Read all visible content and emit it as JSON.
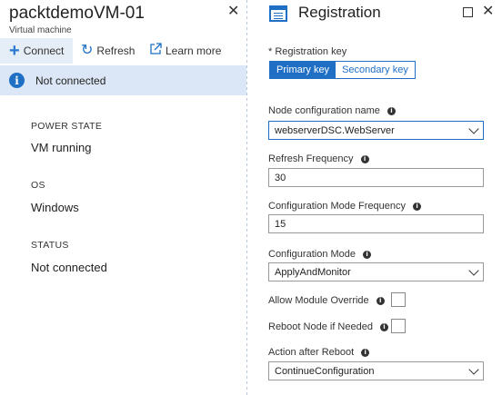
{
  "left_blade": {
    "title": "packtdemoVM-01",
    "subtitle": "Virtual machine",
    "toolbar": {
      "connect_label": "Connect",
      "refresh_label": "Refresh",
      "learn_more_label": "Learn more"
    },
    "banner": {
      "text": "Not connected"
    },
    "properties": [
      {
        "label": "POWER STATE",
        "value": "VM running"
      },
      {
        "label": "OS",
        "value": "Windows"
      },
      {
        "label": "STATUS",
        "value": "Not connected"
      }
    ]
  },
  "right_blade": {
    "title": "Registration",
    "registration_key": {
      "label": "* Registration key",
      "tabs": [
        "Primary key",
        "Secondary key"
      ],
      "selected": "Primary key"
    },
    "fields": {
      "node_configuration_name": {
        "label": "Node configuration name",
        "value": "webserverDSC.WebServer"
      },
      "refresh_frequency": {
        "label": "Refresh Frequency",
        "value": "30"
      },
      "configuration_mode_frequency": {
        "label": "Configuration Mode Frequency",
        "value": "15"
      },
      "configuration_mode": {
        "label": "Configuration Mode",
        "value": "ApplyAndMonitor"
      },
      "allow_module_override": {
        "label": "Allow Module Override",
        "checked": false
      },
      "reboot_node_if_needed": {
        "label": "Reboot Node if Needed",
        "checked": false
      },
      "action_after_reboot": {
        "label": "Action after Reboot",
        "value": "ContinueConfiguration"
      }
    }
  },
  "colors": {
    "accent": "#1f6fc5",
    "banner_bg": "#dbe7f6"
  }
}
